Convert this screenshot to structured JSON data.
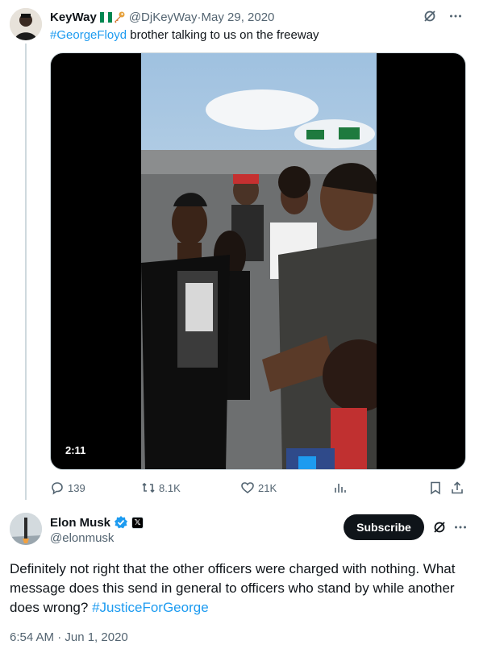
{
  "quoted_tweet": {
    "display_name": "KeyWay",
    "flag_icon": "nigeria-flag-icon",
    "key_icon": "key-icon",
    "handle": "@DjKeyWay",
    "separator": " · ",
    "date": "May 29, 2020",
    "hashtag": "#GeorgeFloyd",
    "text": " brother talking to us on the freeway",
    "video": {
      "duration": "2:11"
    },
    "stats": {
      "replies": "139",
      "reposts": "8.1K",
      "likes": "21K"
    }
  },
  "main_tweet": {
    "display_name": "Elon Musk",
    "handle": "@elonmusk",
    "subscribe_label": "Subscribe",
    "body_text": "Definitely not right that the other officers were charged with nothing. What message does this send in general to officers who stand by while another does wrong? ",
    "hashtag": "#JusticeForGeorge",
    "timestamp": "6:54 AM · Jun 1, 2020"
  },
  "colors": {
    "link": "#1d9bf0",
    "secondary_text": "#536471",
    "primary_text": "#0f1419",
    "border": "#cfd9de",
    "verified": "#1d9bf0"
  }
}
